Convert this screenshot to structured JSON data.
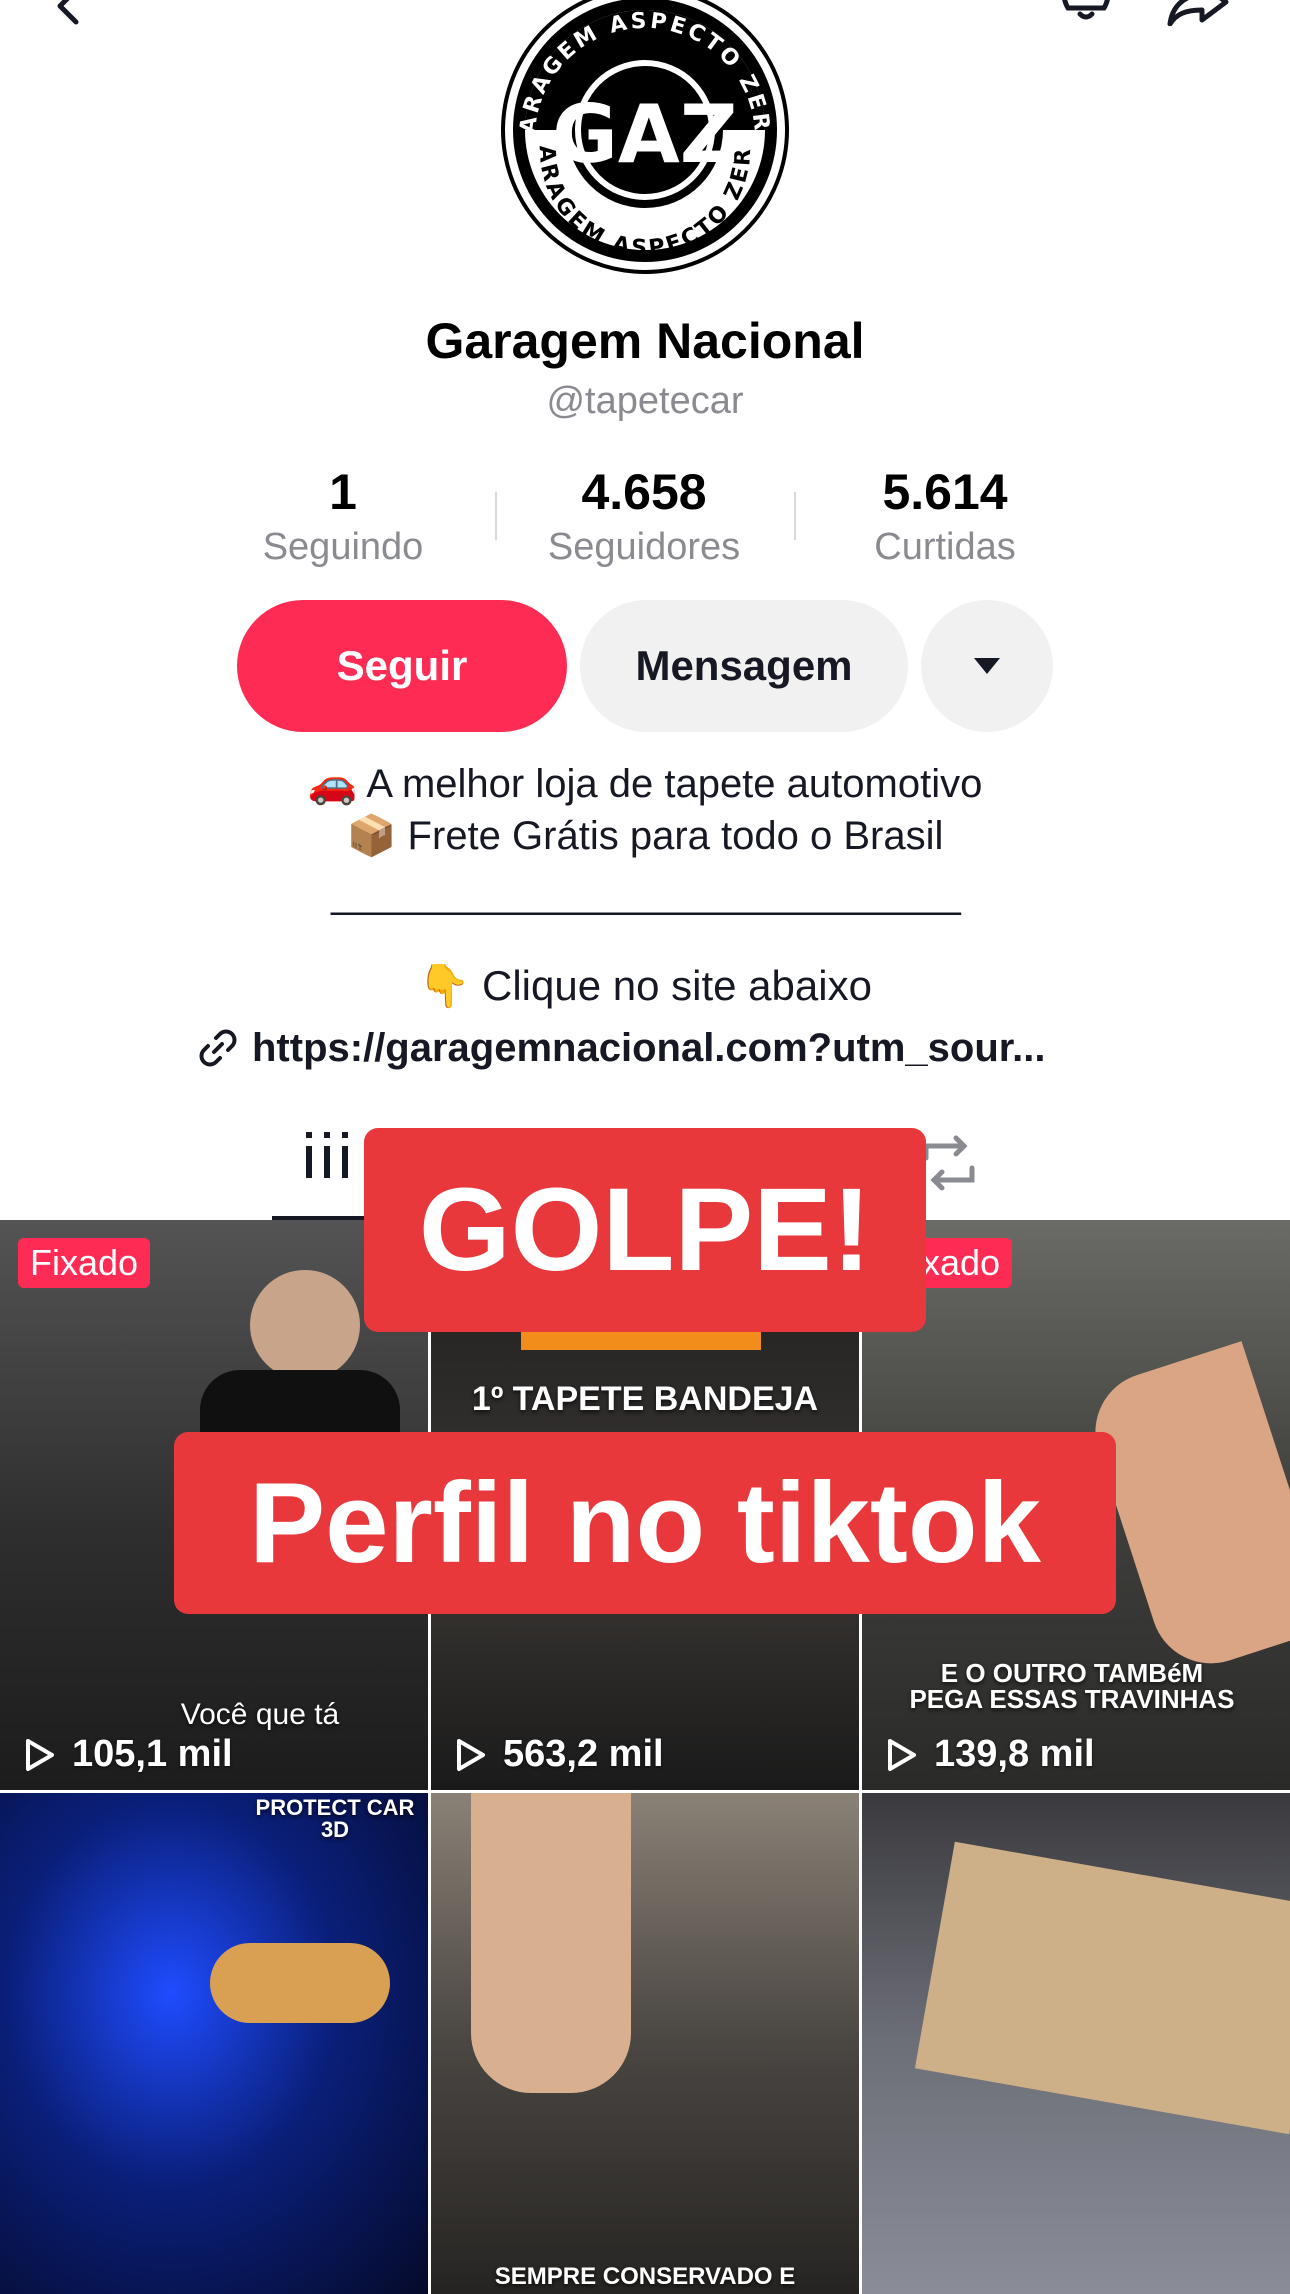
{
  "profile": {
    "name": "Garagem Nacional",
    "handle": "@tapetecar",
    "avatar_ring_text": "GARAGEM ASPECTO ZERO",
    "avatar_initials": "GAZ"
  },
  "stats": [
    {
      "value": "1",
      "label": "Seguindo"
    },
    {
      "value": "4.658",
      "label": "Seguidores"
    },
    {
      "value": "5.614",
      "label": "Curtidas"
    }
  ],
  "actions": {
    "follow_label": "Seguir",
    "message_label": "Mensagem",
    "more_icon": "caret-down-icon"
  },
  "bio": {
    "line1": "🚗 A melhor loja de tapete automotivo",
    "line2": "📦 Frete Grátis para todo o Brasil",
    "separator": "_______________________________",
    "cta": "👇 Clique no site abaixo",
    "link": "https://garagemnacional.com?utm_sour..."
  },
  "tabs": {
    "videos_icon": "grid-icon",
    "repost_icon": "repost-icon"
  },
  "videos": [
    {
      "pinned_label": "Fixado",
      "views": "105,1 mil",
      "caption": "Você que tá",
      "bg": "#3a3a3a"
    },
    {
      "pinned_label": "",
      "views": "563,2 mil",
      "caption": "1º TAPETE BANDEJA",
      "bg": "#2a2a2a"
    },
    {
      "pinned_label": "Fixado",
      "views": "139,8 mil",
      "caption": "E O OUTRO TAMBéM PEGA ESSAS TRAVINHAS",
      "bg": "#4a4a48"
    },
    {
      "pinned_label": "",
      "views": "",
      "caption": "PROTECT CAR 3D",
      "bg": "#0b1a5a"
    },
    {
      "pinned_label": "",
      "views": "",
      "caption": "SEMPRE CONSERVADO E",
      "bg": "#3b3835"
    },
    {
      "pinned_label": "",
      "views": "",
      "caption": "",
      "bg": "#5b5b60"
    }
  ],
  "overlays": {
    "top": "GOLPE!",
    "bottom": "Perfil no tiktok"
  },
  "colors": {
    "accent": "#fe2c55",
    "overlay": "#e8383b",
    "secondary_button": "#f1f1f2"
  }
}
